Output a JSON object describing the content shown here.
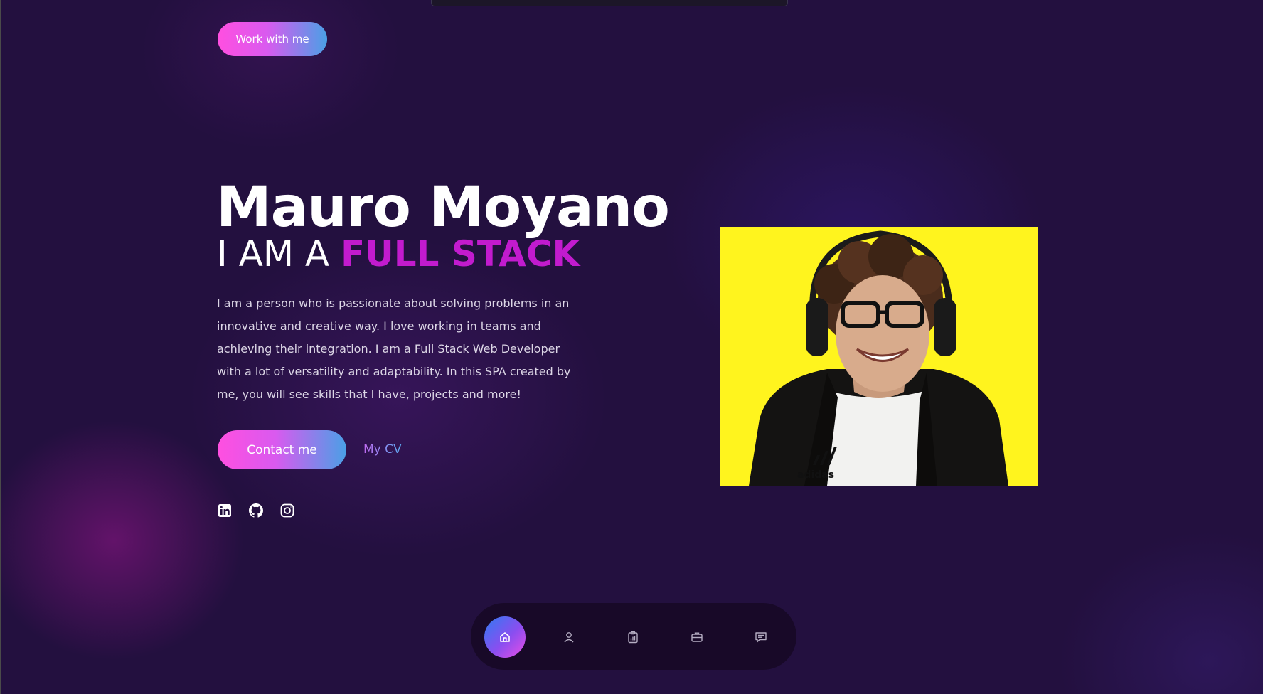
{
  "header": {
    "work_button_label": "Work with me"
  },
  "hero": {
    "name": "Mauro Moyano",
    "role_prefix": "I AM A",
    "role_highlight": "FULL STACK",
    "description": "I am a person who is passionate about solving problems in an innovative and creative way. I love working in teams and achieving their integration. I am a Full Stack Web Developer with a lot of versatility and adaptability. In this SPA created by me, you will see skills that I have, projects and more!",
    "contact_button_label": "Contact me",
    "cv_link_label": "My CV"
  },
  "social": [
    {
      "icon": "linkedin-icon"
    },
    {
      "icon": "github-icon"
    },
    {
      "icon": "instagram-icon"
    }
  ],
  "photo": {
    "background_color": "#fff41e",
    "shirt_text": "adidas"
  },
  "bottom_nav": {
    "items": [
      {
        "icon": "home-icon",
        "active": true
      },
      {
        "icon": "user-icon",
        "active": false
      },
      {
        "icon": "clipboard-chart-icon",
        "active": false
      },
      {
        "icon": "briefcase-icon",
        "active": false
      },
      {
        "icon": "message-icon",
        "active": false
      }
    ]
  },
  "colors": {
    "background": "#23103f",
    "accent_pink": "#ff4fe0",
    "accent_blue": "#4aa0e6",
    "highlight_magenta": "#c21bce"
  }
}
